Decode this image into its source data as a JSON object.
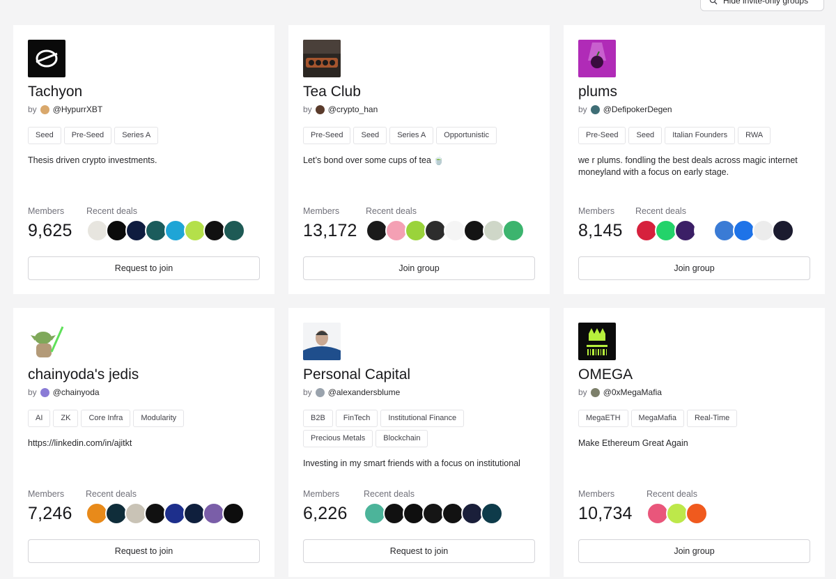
{
  "filter": {
    "label": "Hide invite-only groups"
  },
  "groups": [
    {
      "name": "Tachyon",
      "by": "by",
      "handle": "@HypurrXBT",
      "tags": [
        "Seed",
        "Pre-Seed",
        "Series A"
      ],
      "description": "Thesis driven crypto investments.",
      "members_label": "Members",
      "members": "9,625",
      "deals_label": "Recent deals",
      "deal_colors": [
        "#e7e5df",
        "#0b0b0b",
        "#0f1c3f",
        "#1b5c5c",
        "#1fa5d6",
        "#b4e04a",
        "#111111",
        "#1e5a55"
      ],
      "action": "Request to join"
    },
    {
      "name": "Tea Club",
      "by": "by",
      "handle": "@crypto_han",
      "tags": [
        "Pre-Seed",
        "Seed",
        "Series A",
        "Opportunistic"
      ],
      "description": "Let’s bond over some cups of tea 🍵",
      "members_label": "Members",
      "members": "13,172",
      "deals_label": "Recent deals",
      "deal_colors": [
        "#1a1a1a",
        "#f4a0b4",
        "#9ad33b",
        "#2d2d2d",
        "#f5f5f5",
        "#141414",
        "#cfd7c8",
        "#3cb46e"
      ],
      "action": "Join group"
    },
    {
      "name": "plums",
      "by": "by",
      "handle": "@DefipokerDegen",
      "tags": [
        "Pre-Seed",
        "Seed",
        "Italian Founders",
        "RWA"
      ],
      "description": "we r plums. fondling the best deals across magic internet moneyland with a focus on early stage.",
      "members_label": "Members",
      "members": "8,145",
      "deals_label": "Recent deals",
      "deal_colors": [
        "#d6213d",
        "#23d36a",
        "#3b1f66",
        "#ffffff",
        "#3a7bd5",
        "#1e73e8",
        "#ececec",
        "#1b1b2f"
      ],
      "action": "Join group"
    },
    {
      "name": "chainyoda's jedis",
      "by": "by",
      "handle": "@chainyoda",
      "tags": [
        "AI",
        "ZK",
        "Core Infra",
        "Modularity"
      ],
      "description": "https://linkedin.com/in/ajitkt",
      "members_label": "Members",
      "members": "7,246",
      "deals_label": "Recent deals",
      "deal_colors": [
        "#e88a1a",
        "#0f2d3a",
        "#c9c3b6",
        "#111111",
        "#1d2f8c",
        "#0f1f3d",
        "#7a5ea8",
        "#0d0d0d"
      ],
      "action": "Request to join"
    },
    {
      "name": "Personal Capital",
      "by": "by",
      "handle": "@alexandersblume",
      "tags": [
        "B2B",
        "FinTech",
        "Institutional Finance",
        "Precious Metals",
        "Blockchain"
      ],
      "description": "Investing in my smart friends with a focus on institutional",
      "members_label": "Members",
      "members": "6,226",
      "deals_label": "Recent deals",
      "deal_colors": [
        "#4cb49a",
        "#111111",
        "#0f0f0f",
        "#151515",
        "#121212",
        "#1a1f3a",
        "#0e3b4a"
      ],
      "action": "Request to join"
    },
    {
      "name": "OMEGA",
      "by": "by",
      "handle": "@0xMegaMafia",
      "tags": [
        "MegaETH",
        "MegaMafia",
        "Real-Time"
      ],
      "description": "Make Ethereum Great Again",
      "members_label": "Members",
      "members": "10,734",
      "deals_label": "Recent deals",
      "deal_colors": [
        "#e9567b",
        "#bde84a",
        "#f05a1e"
      ],
      "action": "Join group"
    }
  ]
}
